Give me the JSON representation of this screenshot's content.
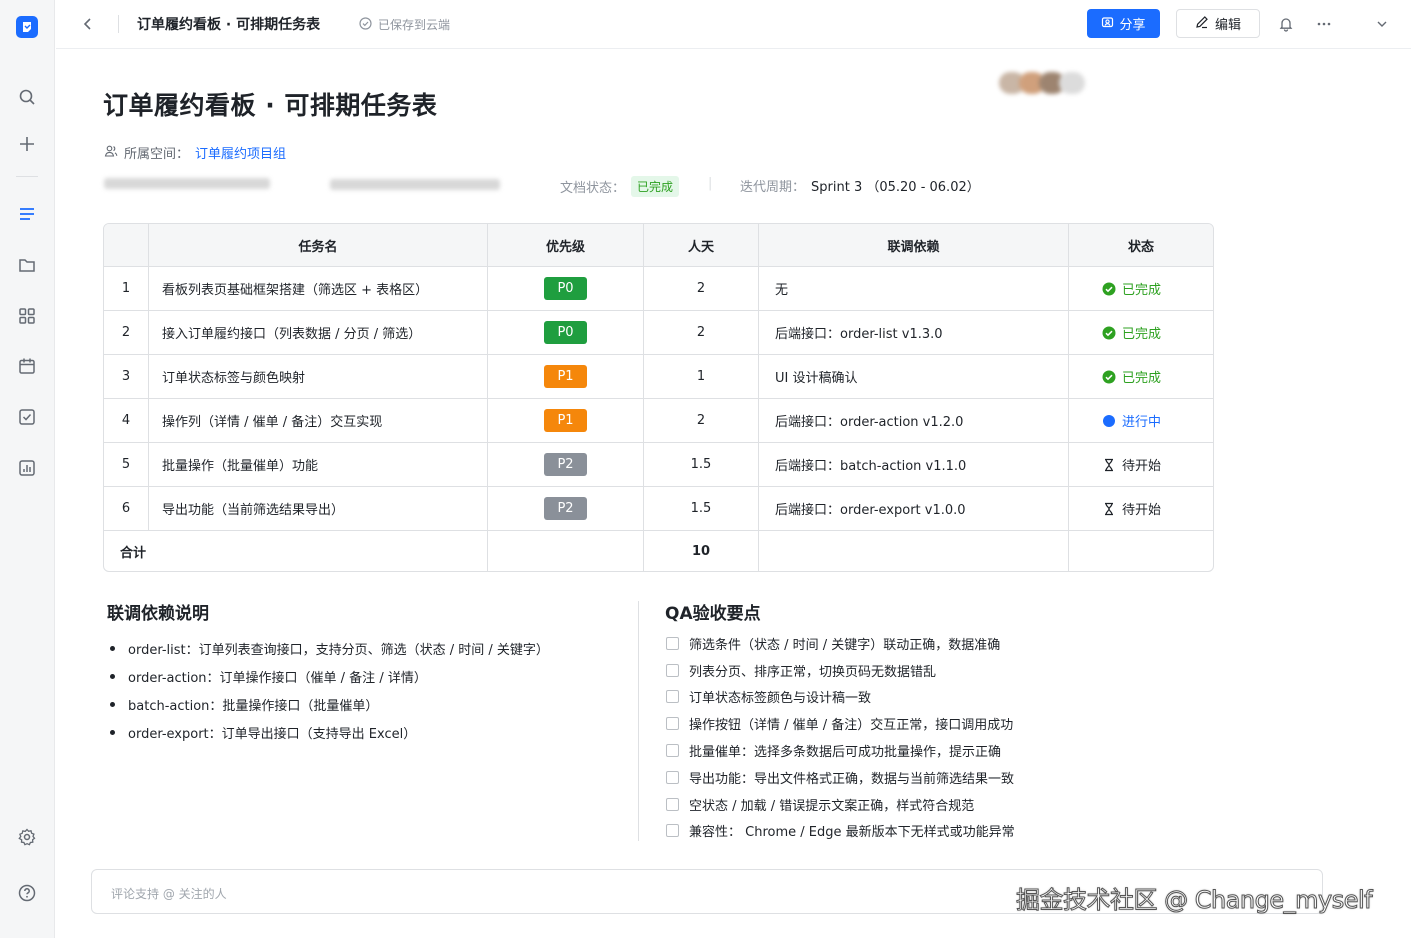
{
  "topbar": {
    "title": "订单履约看板 · 可排期任务表",
    "saved": "已保存到云端",
    "share_label": "分享",
    "edit_label": "编辑"
  },
  "doc": {
    "title": "订单履约看板 · 可排期任务表",
    "space_label": "所属空间：",
    "space_link": "订单履约项目组",
    "status_label": "文档状态：",
    "status_value": "已完成",
    "sprint_label": "迭代周期：",
    "sprint_value": "Sprint 3 （05.20 - 06.02）"
  },
  "colors": {
    "accent": "#1b6cff",
    "p0": "#1f9e3f",
    "p1": "#f5870b",
    "p2": "#8a9099",
    "done": "#2ea121",
    "progress": "#1b6cff"
  },
  "table": {
    "headers": [
      "任务名",
      "优先级",
      "人天",
      "联调依赖",
      "状态"
    ],
    "rows": [
      {
        "idx": "1",
        "name": "看板列表页基础框架搭建（筛选区 + 表格区）",
        "priority": "P0",
        "days": "2",
        "dep": "无",
        "status": "已完成",
        "status_kind": "done"
      },
      {
        "idx": "2",
        "name": "接入订单履约接口（列表数据 / 分页 / 筛选）",
        "priority": "P0",
        "days": "2",
        "dep": "后端接口：order-list v1.3.0",
        "status": "已完成",
        "status_kind": "done"
      },
      {
        "idx": "3",
        "name": "订单状态标签与颜色映射",
        "priority": "P1",
        "days": "1",
        "dep": "UI 设计稿确认",
        "status": "已完成",
        "status_kind": "done"
      },
      {
        "idx": "4",
        "name": "操作列（详情 / 催单 / 备注）交互实现",
        "priority": "P1",
        "days": "2",
        "dep": "后端接口：order-action v1.2.0",
        "status": "进行中",
        "status_kind": "progress"
      },
      {
        "idx": "5",
        "name": "批量操作（批量催单）功能",
        "priority": "P2",
        "days": "1.5",
        "dep": "后端接口：batch-action v1.1.0",
        "status": "待开始",
        "status_kind": "todo"
      },
      {
        "idx": "6",
        "name": "导出功能（当前筛选结果导出）",
        "priority": "P2",
        "days": "1.5",
        "dep": "后端接口：order-export v1.0.0",
        "status": "待开始",
        "status_kind": "todo"
      }
    ],
    "total_label": "合计",
    "total_days": "10"
  },
  "deps": {
    "title": "联调依赖说明",
    "items": [
      "order-list：订单列表查询接口，支持分页、筛选（状态 / 时间 / 关键字）",
      "order-action：订单操作接口（催单 / 备注 / 详情）",
      "batch-action：批量操作接口（批量催单）",
      "order-export：订单导出接口（支持导出 Excel）"
    ]
  },
  "qa": {
    "title": "QA验收要点",
    "items": [
      "筛选条件（状态 / 时间 / 关键字）联动正确，数据准确",
      "列表分页、排序正常，切换页码无数据错乱",
      "订单状态标签颜色与设计稿一致",
      "操作按钮（详情 / 催单 / 备注）交互正常，接口调用成功",
      "批量催单：选择多条数据后可成功批量操作，提示正确",
      "导出功能：导出文件格式正确，数据与当前筛选结果一致",
      "空状态 / 加载 / 错误提示文案正确，样式符合规范",
      "兼容性： Chrome / Edge 最新版本下无样式或功能异常"
    ]
  },
  "comment": {
    "placeholder": "评论支持 @ 关注的人"
  },
  "watermark": "掘金技术社区 @ Change_myself"
}
